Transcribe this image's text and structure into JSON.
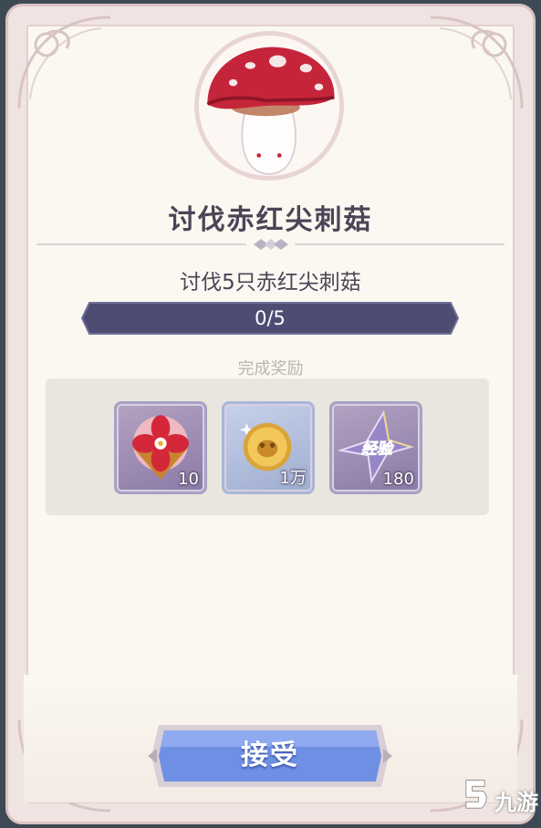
{
  "quest": {
    "title": "讨伐赤红尖刺菇",
    "objective": "讨伐5只赤红尖刺菇",
    "progress_text": "0/5",
    "progress": {
      "current": 0,
      "total": 5
    }
  },
  "rewards": {
    "label": "完成奖励",
    "items": [
      {
        "icon": "flower-emblem-icon",
        "count": "10"
      },
      {
        "icon": "gold-coin-icon",
        "count": "1万"
      },
      {
        "icon": "experience-crystal-icon",
        "count": "180",
        "icon_text": "经验"
      }
    ]
  },
  "buttons": {
    "accept_label": "接受"
  },
  "watermark": {
    "text": "九游"
  },
  "colors": {
    "progress_bar": "#4f4c74",
    "accept_button": "#6f8fe4",
    "title_text": "#4a4556",
    "panel_bg": "#fbf8f1"
  }
}
